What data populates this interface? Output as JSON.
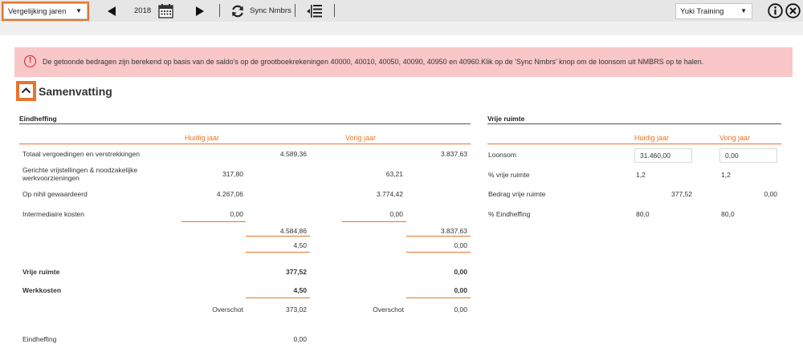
{
  "toolbar": {
    "view_select": "Vergelijking jaren",
    "year": "2018",
    "sync_label": "Sync Nmbrs",
    "admin_select": "Yuki Training"
  },
  "alert": {
    "message": "De getoonde bedragen zijn berekend op basis van de saldo's op de grootboekrekeningen 40000, 40010, 40050, 40090, 40950 en 40960.Klik op de 'Sync Nmbrs' knop om de loonsom uit NMBRS op te halen."
  },
  "section_title": "Samenvatting",
  "eindheffing": {
    "title": "Eindheffing",
    "col_current": "Huidig jaar",
    "col_previous": "Vorig jaar",
    "rows": [
      {
        "label": "Totaal vergoedingen en verstrekkingen",
        "cur_total": "4.589,36",
        "prev_total": "3.837,63"
      },
      {
        "label": "Gerichte vrijstellingen & noodzakelijke werkvoorzieningen",
        "cur": "317,80",
        "prev": "63,21"
      },
      {
        "label": "Op nihil gewaardeerd",
        "cur": "4.267,06",
        "prev": "3.774,42"
      },
      {
        "label": "Intermediaire kosten",
        "cur": "0,00",
        "prev": "0,00"
      }
    ],
    "subtotal_cur": "4.584,86",
    "subtotal_prev": "3.837,63",
    "diff_cur": "4,50",
    "diff_prev": "0,00",
    "vrije_ruimte_label": "Vrije ruimte",
    "vrije_ruimte_cur": "377,52",
    "vrije_ruimte_prev": "0,00",
    "werkkosten_label": "Werkkosten",
    "werkkosten_cur": "4,50",
    "werkkosten_prev": "0,00",
    "overschot_label": "Overschot",
    "overschot_cur": "373,02",
    "overschot_prev": "0,00",
    "eindheffing_label": "Eindheffing",
    "eindheffing_cur": "0,00"
  },
  "vrije_ruimte": {
    "title": "Vrije ruimte",
    "col_current": "Huidig jaar",
    "col_previous": "Vorig jaar",
    "loonsom_label": "Loonsom",
    "loonsom_cur": "31.460,00",
    "loonsom_prev": "0,00",
    "pct_label": "% vrije ruimte",
    "pct_cur": "1,2",
    "pct_prev": "1,2",
    "bedrag_label": "Bedrag vrije ruimte",
    "bedrag_cur": "377,52",
    "bedrag_prev": "0,00",
    "eind_label": "% Eindheffing",
    "eind_cur": "80,0",
    "eind_prev": "80,0"
  },
  "colors": {
    "accent": "#e8742b",
    "alert_bg": "#f9c7c8",
    "alert_icon": "#d0202a"
  }
}
